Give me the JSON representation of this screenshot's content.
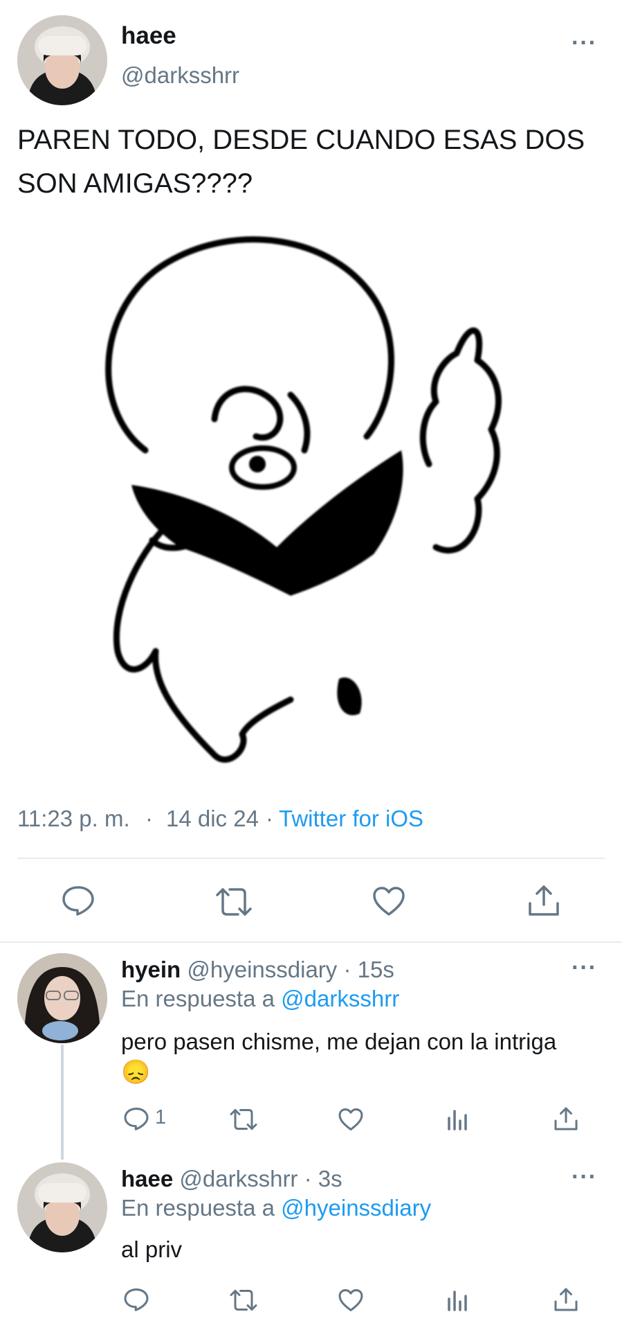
{
  "tweet": {
    "display_name": "haee",
    "handle": "@darksshrr",
    "text_line1": "PAREN TODO, DESDE CUANDO ESAS DOS",
    "text_line2": "SON AMIGAS????",
    "time": "11:23 p. m.",
    "dot": "·",
    "date": "14 dic 24",
    "dot2": "·",
    "source": "Twitter for iOS",
    "more": "···"
  },
  "replies": [
    {
      "display_name": "hyein",
      "handle": "@hyeinssdiary",
      "age": "· 15s",
      "in_reply_prefix": "En respuesta a",
      "in_reply_handle": "@darksshrr",
      "text": "pero pasen chisme, me dejan con la intriga",
      "emoji": "😞",
      "reply_count": "1",
      "more": "···"
    },
    {
      "display_name": "haee",
      "handle": "@darksshrr",
      "age": "· 3s",
      "in_reply_prefix": "En respuesta a",
      "in_reply_handle": "@hyeinssdiary",
      "text": "al priv",
      "more": "···"
    }
  ],
  "icons": [
    "reply-icon",
    "retweet-icon",
    "like-icon",
    "share-icon",
    "analytics-icon",
    "more-icon"
  ],
  "colors": {
    "link": "#1d9bf0",
    "muted": "#657786",
    "divider": "#e6ecf0",
    "text": "#14171a"
  }
}
